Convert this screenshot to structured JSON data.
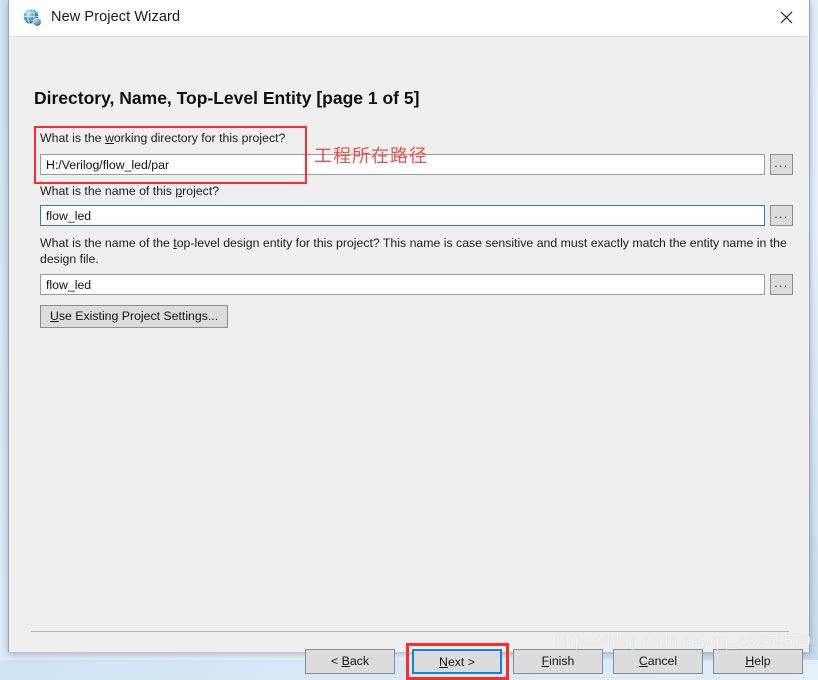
{
  "window": {
    "title": "New Project Wizard",
    "icon": "globe-icon",
    "close_label": "✕"
  },
  "page": {
    "heading": "Directory, Name, Top-Level Entity [page 1 of 5]"
  },
  "fields": [
    {
      "name": "working-directory",
      "label_before": "What is the ",
      "label_mnemonic": "w",
      "label_after": "orking directory for this project?",
      "label_full": "What is the working directory for this project?",
      "value": "H:/Verilog/flow_led/par",
      "placeholder": "",
      "focused": false,
      "browse_label": "..."
    },
    {
      "name": "project-name",
      "label_before": "What is the name of this ",
      "label_mnemonic": "p",
      "label_after": "roject?",
      "label_full": "What is the name of this project?",
      "value": "flow_led",
      "placeholder": "",
      "focused": true,
      "browse_label": "..."
    },
    {
      "name": "top-level-entity",
      "label_before": "What is the name of the ",
      "label_mnemonic": "t",
      "label_after": "op-level design entity for this project? This name is case sensitive and must exactly match the entity name in the design file.",
      "label_full": "What is the name of the top-level design entity for this project? This name is case sensitive and must exactly match the entity name in the design file.",
      "value": "flow_led",
      "placeholder": "",
      "focused": false,
      "browse_label": "..."
    }
  ],
  "use_existing_button": {
    "label_mnemonic": "U",
    "label_after": "se Existing Project Settings..."
  },
  "footer_buttons": [
    {
      "name": "back",
      "before": "< ",
      "mnemonic": "B",
      "after": "ack"
    },
    {
      "name": "next",
      "before": "",
      "mnemonic": "N",
      "after": "ext >"
    },
    {
      "name": "finish",
      "before": "",
      "mnemonic": "F",
      "after": "inish"
    },
    {
      "name": "cancel",
      "before": "",
      "mnemonic": "C",
      "after": "ancel"
    },
    {
      "name": "help",
      "before": "",
      "mnemonic": "H",
      "after": "elp"
    }
  ],
  "annotations": {
    "directory_note": "工程所在路径",
    "highlight_color": "#ff2b2b"
  },
  "watermark": {
    "text": "https://blog.csdn.net/qq_43279579"
  }
}
